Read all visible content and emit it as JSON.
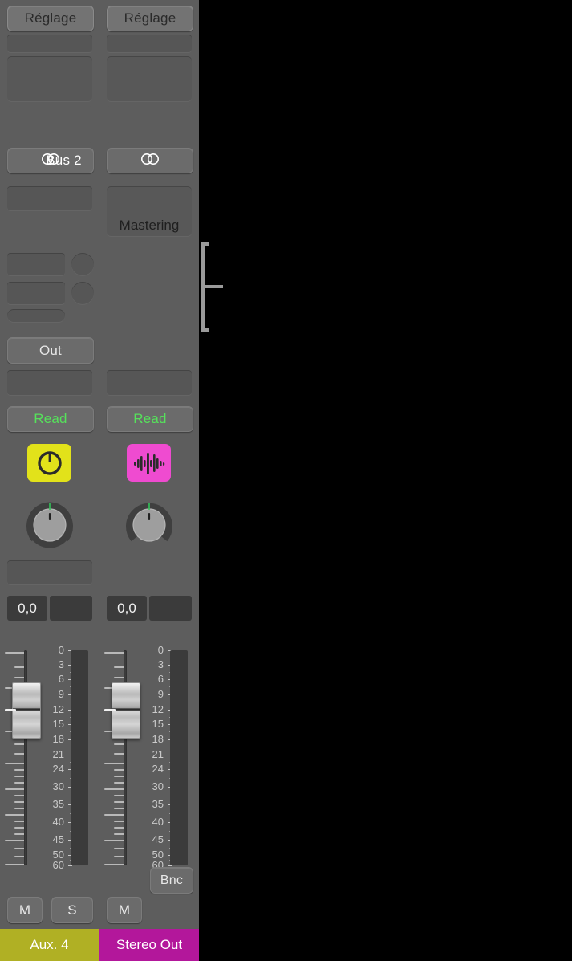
{
  "app": {
    "background": "#000000",
    "panel_bg": "#5d5d5d"
  },
  "channel_strips": [
    {
      "id": "aux-4",
      "setting_button": "Réglage",
      "io_label": "Bus 2",
      "io_icon": "stereo-circles-icon",
      "send_label": "",
      "output_button": "Out",
      "automation_mode": "Read",
      "plugin_icon": {
        "name": "pan-knob-icon",
        "color": "#e2e21a"
      },
      "pan_value": "",
      "volume_value": "0,0",
      "peak_value": "",
      "mute_label": "M",
      "solo_label": "S",
      "bounce_label": "",
      "track_name": "Aux. 4",
      "track_color": "#b0b024",
      "fader_db": -10.5,
      "scale_labels": [
        "0",
        "3",
        "6",
        "9",
        "12",
        "15",
        "18",
        "21",
        "24",
        "30",
        "35",
        "40",
        "45",
        "50",
        "60"
      ]
    },
    {
      "id": "stereo-out",
      "setting_button": "Réglage",
      "io_label": "",
      "io_icon": "stereo-circles-icon",
      "send_label": "Mastering",
      "output_button": "",
      "automation_mode": "Read",
      "plugin_icon": {
        "name": "waveform-icon",
        "color": "#ef4bd0"
      },
      "pan_value": "",
      "volume_value": "0,0",
      "peak_value": "",
      "mute_label": "M",
      "solo_label": "",
      "bounce_label": "Bnc",
      "track_name": "Stereo Out",
      "track_color": "#b3179b",
      "fader_db": -10.5,
      "scale_labels": [
        "0",
        "3",
        "6",
        "9",
        "12",
        "15",
        "18",
        "21",
        "24",
        "30",
        "35",
        "40",
        "45",
        "50",
        "60"
      ]
    }
  ],
  "callout": {
    "name": "callout-bracket",
    "color": "#9a9a9a"
  },
  "colors": {
    "automation_green": "#56e25b",
    "aux_track": "#b0b024",
    "stereo_out_track": "#b3179b",
    "plugin_yellow": "#e2e21a",
    "plugin_pink": "#ef4bd0"
  }
}
